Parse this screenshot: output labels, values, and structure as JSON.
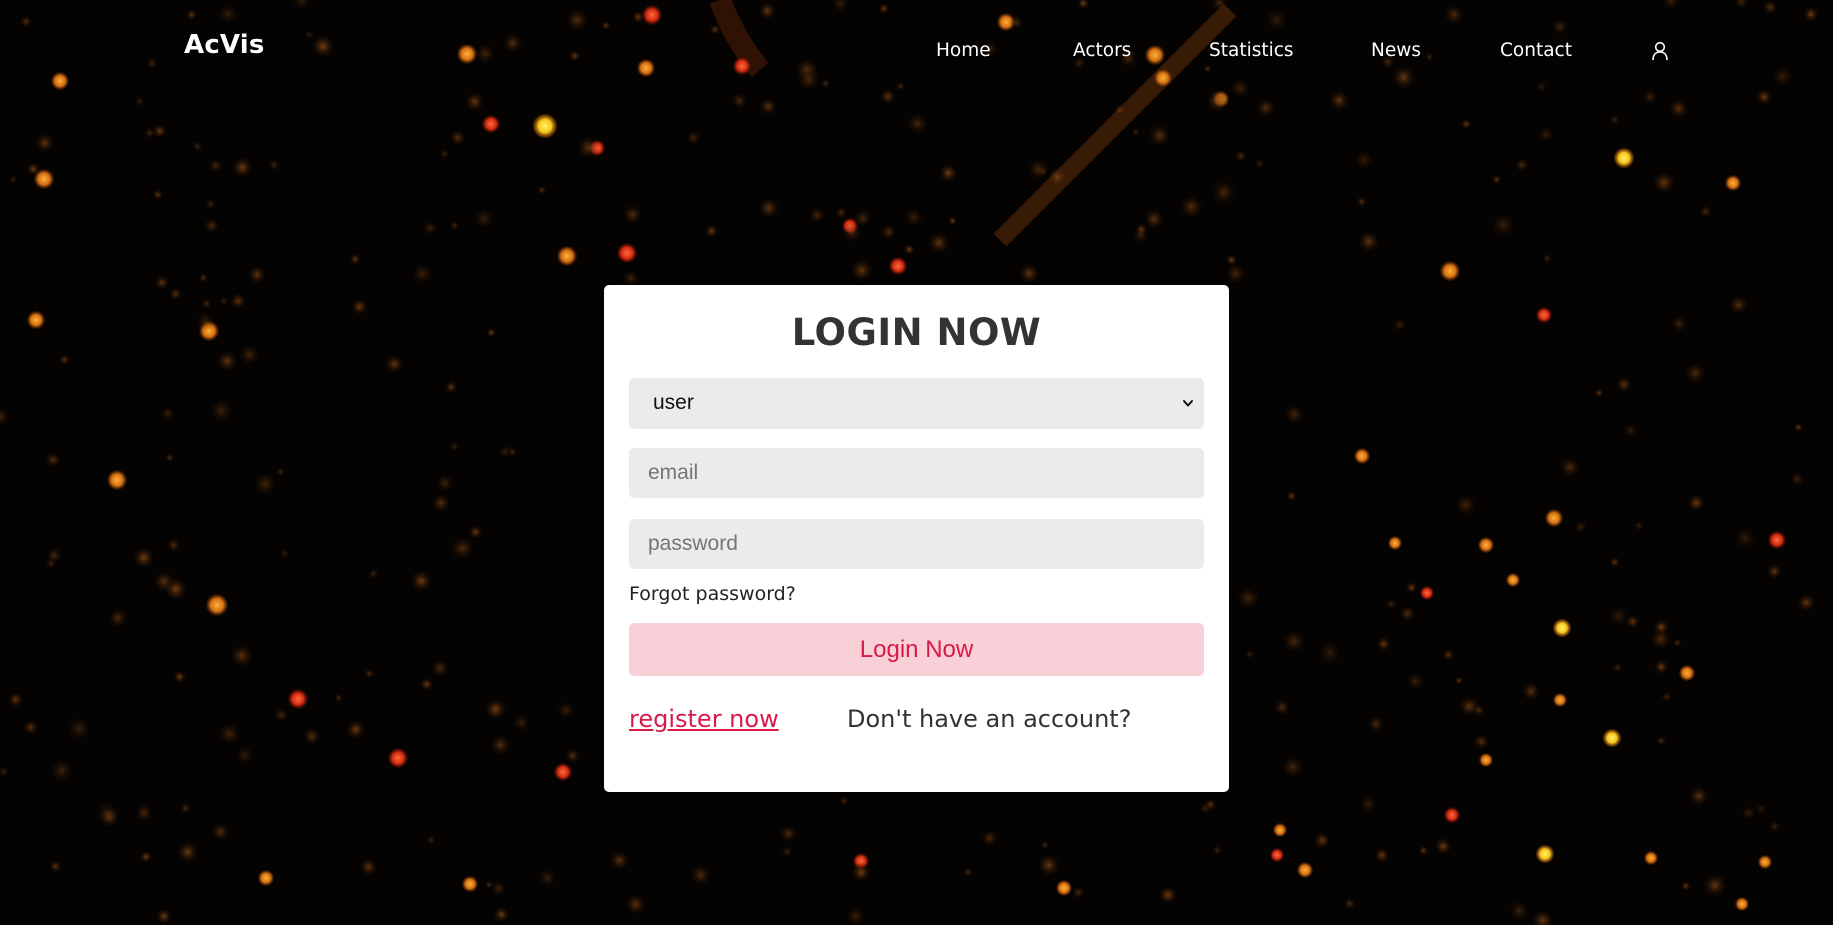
{
  "navbar": {
    "logo": "AcVis",
    "links": [
      {
        "label": "Home"
      },
      {
        "label": "Actors"
      },
      {
        "label": "Statistics"
      },
      {
        "label": "News"
      },
      {
        "label": "Contact"
      }
    ],
    "account_icon": "user-icon"
  },
  "login": {
    "title": "LOGIN NOW",
    "role_select": {
      "selected": "user"
    },
    "email_placeholder": "email",
    "password_placeholder": "password",
    "forgot_label": "Forgot password?",
    "submit_label": "Login Now",
    "register_label": "register now",
    "no_account_text": "Don't have an account?"
  },
  "colors": {
    "accent": "#d81b46",
    "button_bg": "#f9d0d8",
    "field_bg": "#ebebeb",
    "card_bg": "#ffffff",
    "page_bg": "#050302"
  }
}
